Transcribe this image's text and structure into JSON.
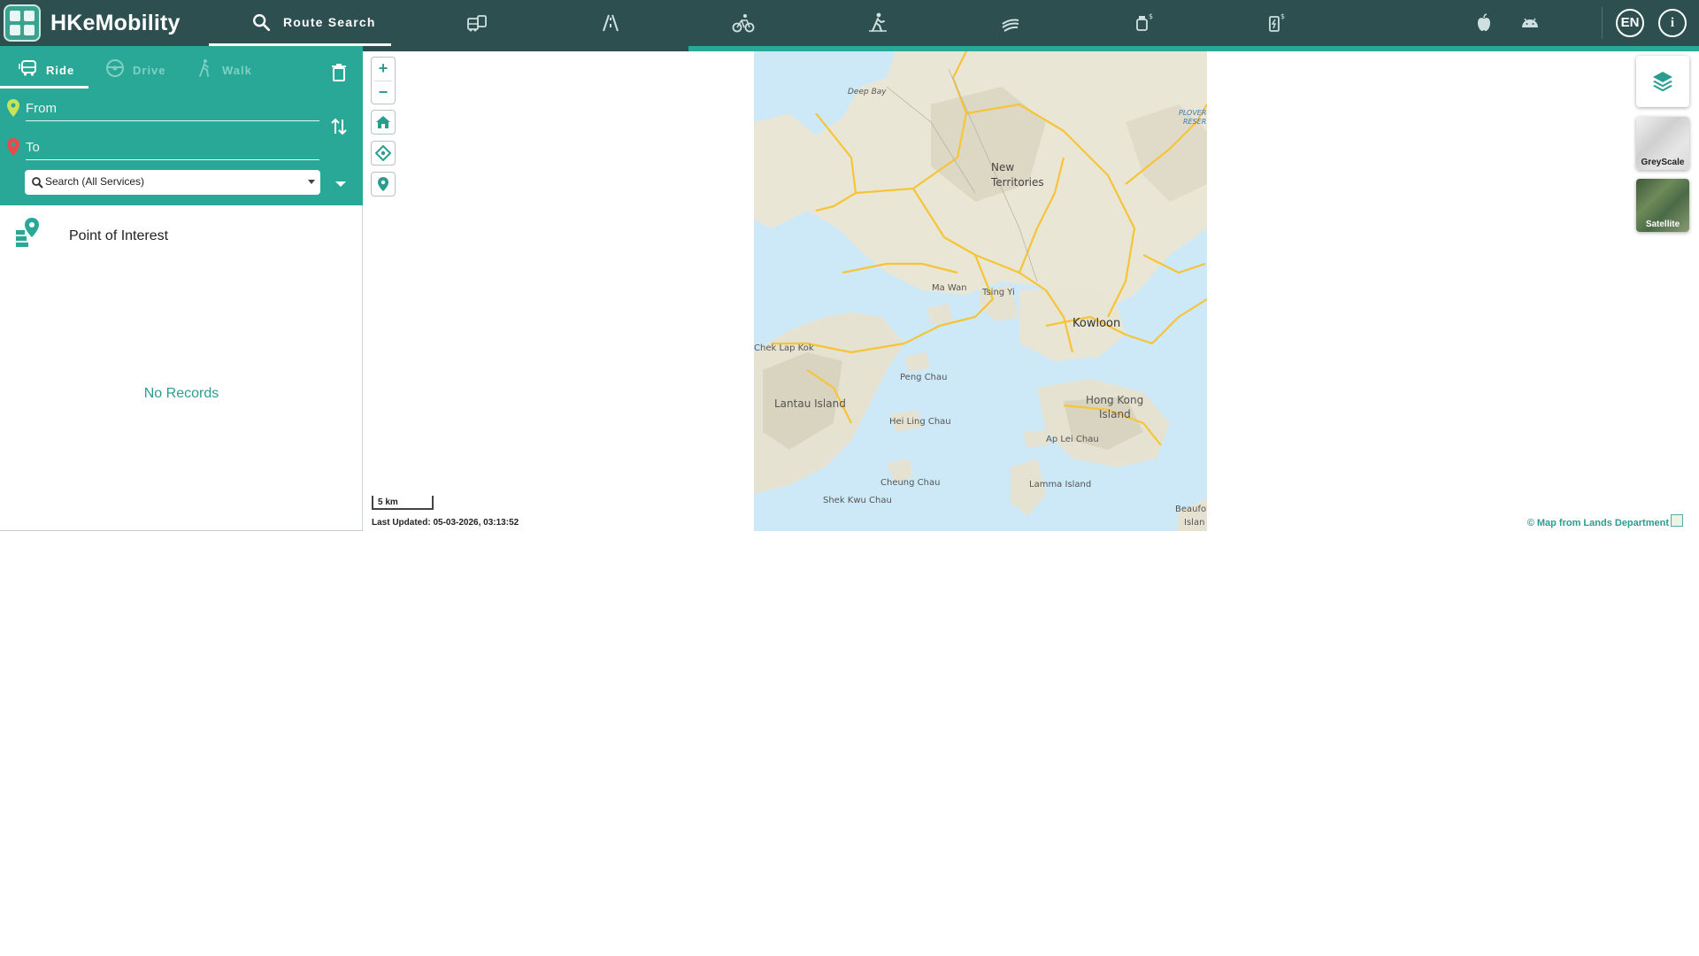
{
  "app": {
    "title": "HKeMobility"
  },
  "nav": {
    "route_search_label": "Route Search",
    "icons": [
      "public-transport-icon",
      "road-icon",
      "cycling-icon",
      "walking-icon",
      "ferry-icon",
      "parking-icon",
      "ev-charging-icon"
    ],
    "language": "EN",
    "info": "i"
  },
  "panel": {
    "modes": [
      {
        "label": "Ride",
        "active": true
      },
      {
        "label": "Drive",
        "active": false
      },
      {
        "label": "Walk",
        "active": false
      }
    ],
    "from_placeholder": "From",
    "to_placeholder": "To",
    "search_select": "Search (All Services)",
    "poi_label": "Point of Interest",
    "empty_text": "No Records"
  },
  "map": {
    "scale_label": "5 km",
    "last_updated": "Last Updated: 05-03-2026, 03:13:52",
    "attribution": "© Map from Lands Department",
    "basemaps": [
      {
        "label": "GreyScale"
      },
      {
        "label": "Satellite"
      }
    ],
    "labels": [
      "Deep Bay",
      "New Territories",
      "Ma Wan",
      "Tsing Yi",
      "Kowloon",
      "Chek Lap Kok",
      "Peng Chau",
      "Lantau Island",
      "Hei Ling Chau",
      "Hong Kong Island",
      "Ap Lei Chau",
      "Cheung Chau",
      "Lamma Island",
      "Shek Kwu Chau",
      "Beaufort Island",
      "PLOVER COVE RESERVOIR"
    ]
  },
  "colors": {
    "topbar": "#2d4f4f",
    "accent": "#2aa897",
    "link": "#2a9d8f"
  },
  "loading_progress": 0.405
}
